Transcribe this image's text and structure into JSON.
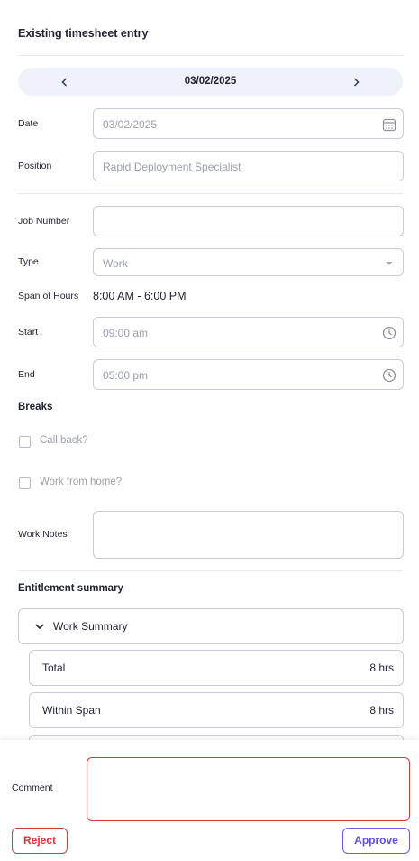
{
  "header": {
    "title": "Existing timesheet entry"
  },
  "date_nav": {
    "date": "03/02/2025"
  },
  "form": {
    "date": {
      "label": "Date",
      "value": "03/02/2025"
    },
    "position": {
      "label": "Position",
      "value": "Rapid Deployment Specialist"
    },
    "job_number": {
      "label": "Job Number",
      "value": ""
    },
    "type": {
      "label": "Type",
      "value": "Work"
    },
    "span": {
      "label": "Span of Hours",
      "value": "8:00 AM - 6:00 PM"
    },
    "start": {
      "label": "Start",
      "value": "09:00 am"
    },
    "end": {
      "label": "End",
      "value": "05:00 pm"
    }
  },
  "breaks": {
    "heading": "Breaks",
    "call_back": {
      "label": "Call back?",
      "checked": false
    },
    "work_from_home": {
      "label": "Work from home?",
      "checked": false
    }
  },
  "notes": {
    "label": "Work Notes",
    "value": ""
  },
  "entitlement": {
    "heading": "Entitlement summary",
    "accordion_title": "Work Summary",
    "rows": [
      {
        "label": "Total",
        "value": "8 hrs"
      },
      {
        "label": "Within Span",
        "value": "8 hrs"
      }
    ]
  },
  "footer": {
    "comment_label": "Comment",
    "comment_value": "",
    "reject_label": "Reject",
    "approve_label": "Approve"
  },
  "colors": {
    "accent": "#5b4fe0",
    "danger": "#d5393a",
    "nav_bg": "#eef2fb",
    "border": "#c8ccd5"
  },
  "icons": {
    "prev": "chevron-left-icon",
    "next": "chevron-right-icon",
    "date_field": "calendar-icon",
    "type_field": "caret-down-icon",
    "time_field": "clock-icon",
    "accordion": "chevron-down-icon"
  }
}
